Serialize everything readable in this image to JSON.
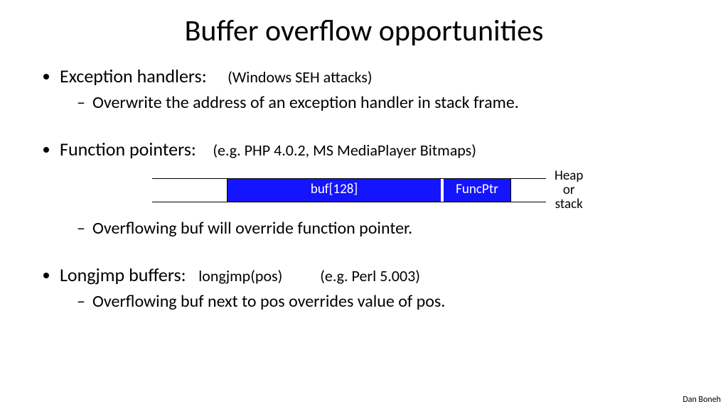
{
  "title": "Buffer overflow opportunities",
  "bullets": {
    "b1": {
      "head": "Exception handlers:",
      "paren": "(Windows SEH attacks)",
      "sub": "Overwrite the address of an exception handler in stack frame."
    },
    "b2": {
      "head": "Function pointers:",
      "paren": "(e.g.  PHP 4.0.2,   MS MediaPlayer Bitmaps)",
      "sub": "Overflowing  buf  will override function pointer."
    },
    "b3": {
      "head": "Longjmp buffers:",
      "call": "longjmp(pos)",
      "paren": "(e.g. Perl 5.003)",
      "sub": "Overflowing buf next to pos overrides value of pos."
    }
  },
  "diagram": {
    "buf": "buf[128]",
    "func": "FuncPtr",
    "side": "Heap\nor\nstack"
  },
  "footer": "Dan Boneh"
}
